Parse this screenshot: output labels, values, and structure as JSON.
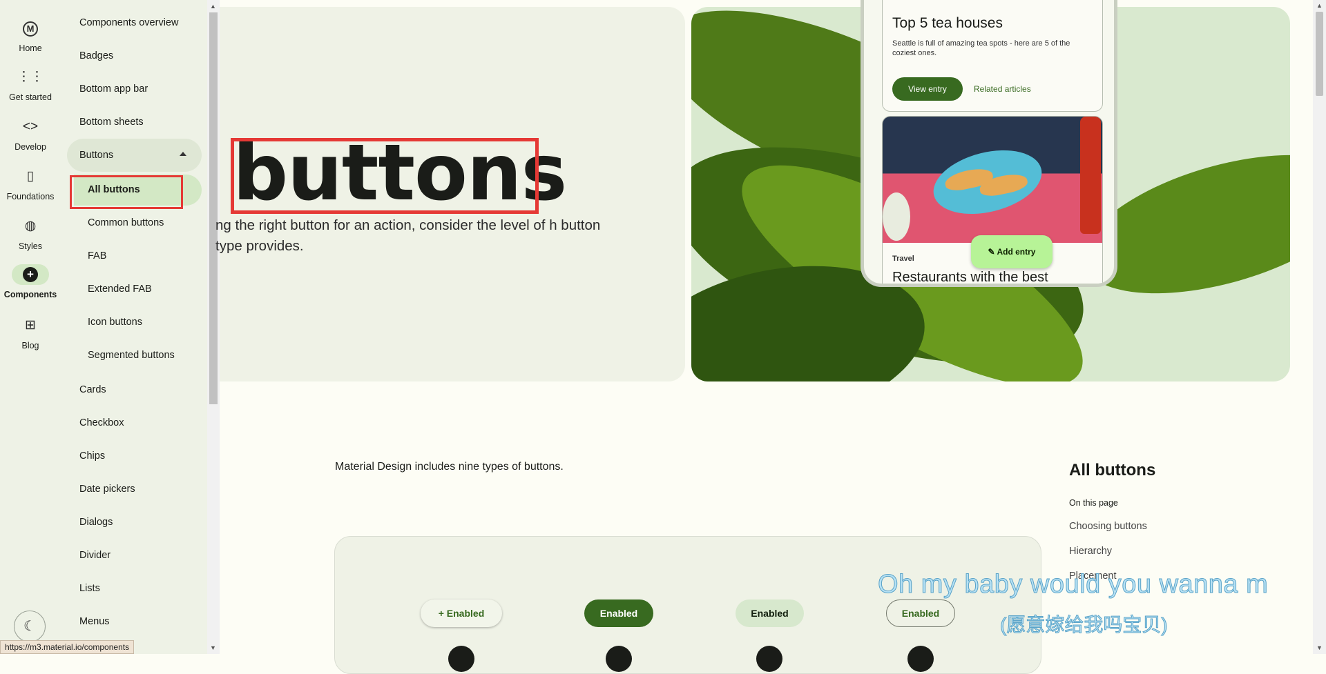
{
  "rail": {
    "items": [
      {
        "label": "Home",
        "icon": "material-logo-icon"
      },
      {
        "label": "Get started",
        "icon": "apps-grid-icon"
      },
      {
        "label": "Develop",
        "icon": "code-icon"
      },
      {
        "label": "Foundations",
        "icon": "book-icon"
      },
      {
        "label": "Styles",
        "icon": "palette-icon"
      },
      {
        "label": "Components",
        "icon": "add-circle-icon"
      },
      {
        "label": "Blog",
        "icon": "add-box-icon"
      }
    ]
  },
  "sidenav": {
    "items_top": [
      "Components overview",
      "Badges",
      "Bottom app bar",
      "Bottom sheets"
    ],
    "group_label": "Buttons",
    "active_label": "All buttons",
    "sub_items": [
      "Common buttons",
      "FAB",
      "Extended FAB",
      "Icon buttons",
      "Segmented buttons"
    ],
    "items_bottom": [
      "Cards",
      "Checkbox",
      "Chips",
      "Date pickers",
      "Dialogs",
      "Divider",
      "Lists",
      "Menus"
    ]
  },
  "hero": {
    "title": "buttons",
    "description": "ng the right button for an action, consider the level of h button type provides."
  },
  "phone": {
    "card1_title": "Top 5 tea houses",
    "card1_text": "Seattle is full of amazing tea spots - here are 5 of the coziest ones.",
    "view_entry": "View entry",
    "related_articles": "Related articles",
    "card2_tag": "Travel",
    "card2_title": "Restaurants with the best",
    "fab_label": "Add entry"
  },
  "main": {
    "intro": "Material Design includes nine types of buttons.",
    "demo_buttons": [
      "Enabled",
      "Enabled",
      "Enabled",
      "Enabled"
    ]
  },
  "toc": {
    "title": "All buttons",
    "subtitle": "On this page",
    "links": [
      "Choosing buttons",
      "Hierarchy",
      "Placement"
    ]
  },
  "overlay": {
    "lyric_line1": "Oh my  baby   would you  wanna m",
    "lyric_line2": "(愿意嫁给我吗宝贝)"
  },
  "status_url": "https://m3.material.io/components",
  "colors": {
    "primary": "#386a20",
    "highlight": "#e53935",
    "active_indicator": "#d3e8c5"
  }
}
